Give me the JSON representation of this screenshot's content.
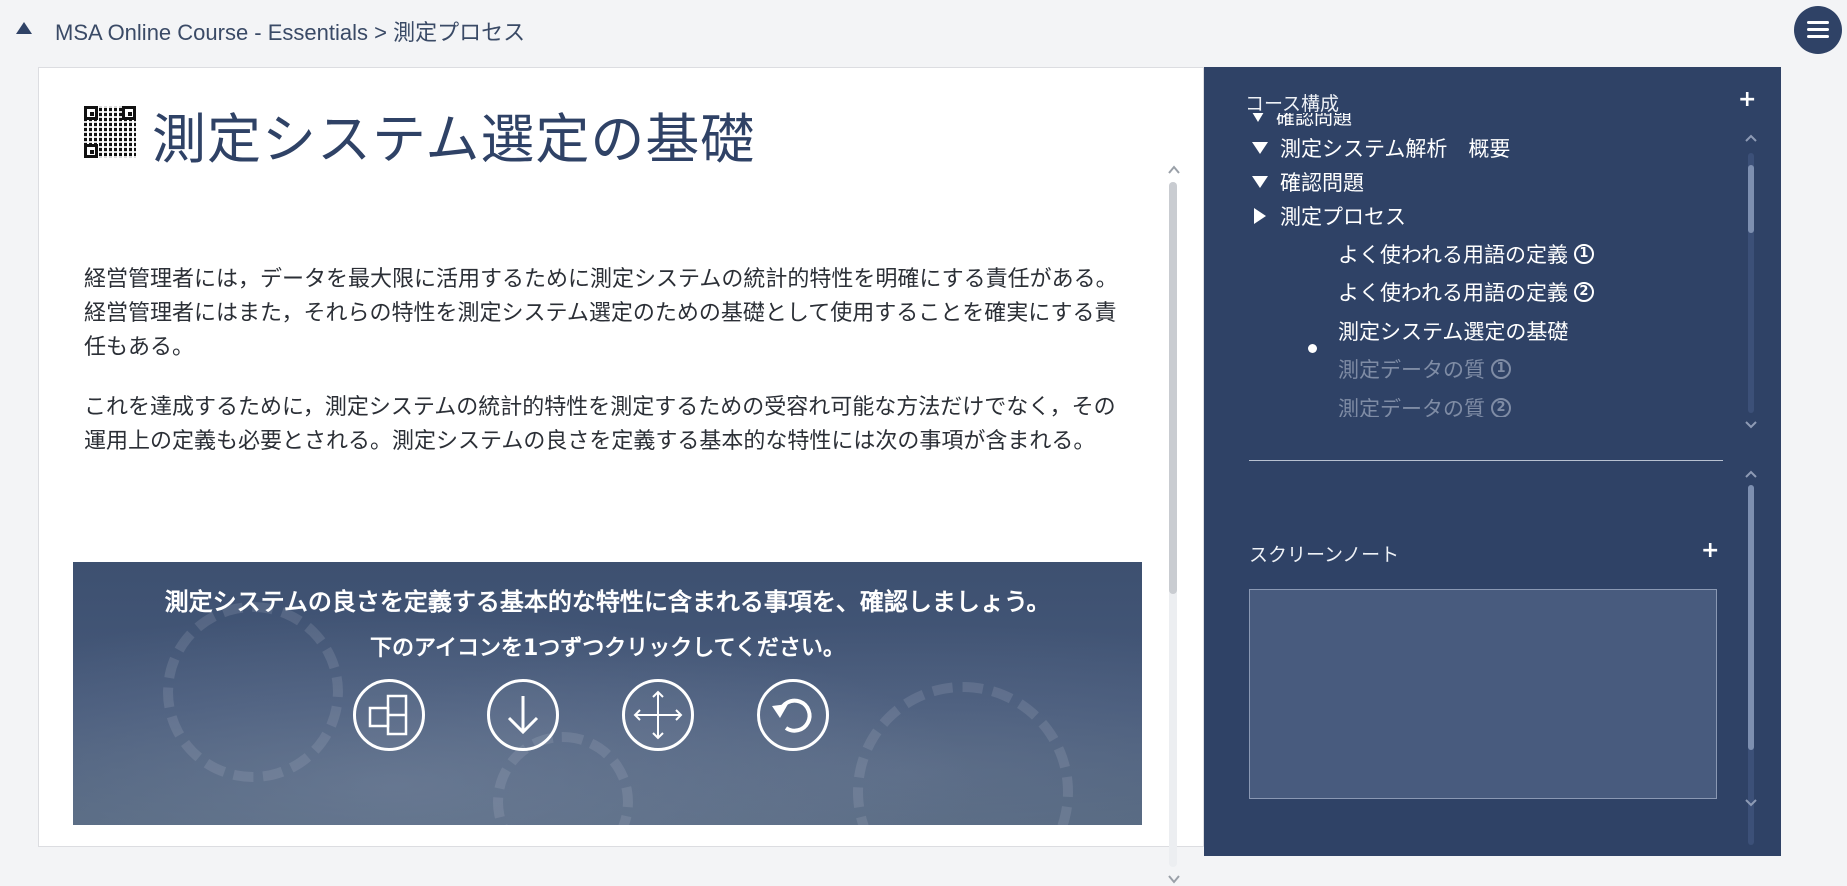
{
  "breadcrumb": "MSA Online Course - Essentials > 測定プロセス",
  "page": {
    "title": "測定システム選定の基礎",
    "paragraphs": [
      "経営管理者には，データを最大限に活用するために測定システムの統計的特性を明確にする責任がある。経営管理者にはまた，それらの特性を測定システム選定のための基礎として使用することを確実にする責任もある。",
      "これを達成するために，測定システムの統計的特性を測定するための受容れ可能な方法だけでなく，その運用上の定義も必要とされる。測定システムの良さを定義する基本的な特性には次の事項が含まれる。"
    ]
  },
  "banner": {
    "line1": "測定システムの良さを定義する基本的な特性に含まれる事項を、確認しましょう。",
    "line2": "下のアイコンを1つずつクリックしてください。",
    "icons": [
      "compare-icon",
      "arrow-down-icon",
      "move-arrows-icon",
      "undo-icon"
    ]
  },
  "course_panel": {
    "title": "コース構成",
    "items": [
      {
        "label": "確認問題",
        "marker": "down",
        "clipped": true
      },
      {
        "label": "測定システム解析　概要",
        "marker": "down"
      },
      {
        "label": "確認問題",
        "marker": "down"
      },
      {
        "label": "測定プロセス",
        "marker": "right"
      },
      {
        "label": "よく使われる用語の定義",
        "num": "1"
      },
      {
        "label": "よく使われる用語の定義",
        "num": "2"
      },
      {
        "label": "測定システム選定の基礎",
        "current": true
      },
      {
        "label": "測定データの質",
        "num": "1",
        "dim": true
      },
      {
        "label": "測定データの質",
        "num": "2",
        "dim": true
      }
    ]
  },
  "notes_panel": {
    "title": "スクリーンノート",
    "value": ""
  },
  "colors": {
    "panel_bg": "#2f4266",
    "title": "#2f4266",
    "banner_bg": "#46597a"
  }
}
